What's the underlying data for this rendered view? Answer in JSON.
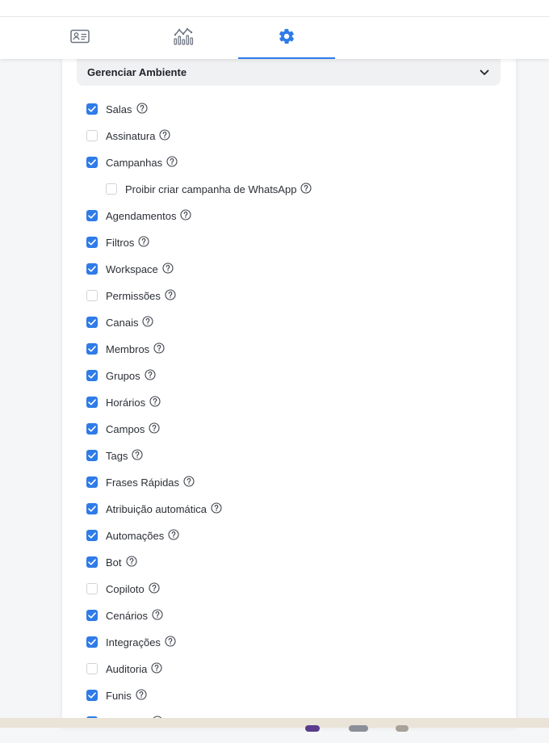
{
  "colors": {
    "accent": "#2f7be8",
    "tab_icon_gray": "#6b7280"
  },
  "tabs": [
    {
      "icon": "contact-card-icon",
      "active": false
    },
    {
      "icon": "analytics-chart-icon",
      "active": false
    },
    {
      "icon": "gear-icon",
      "active": true
    }
  ],
  "section": {
    "title": "Gerenciar Ambiente",
    "expanded": true
  },
  "options": [
    {
      "label": "Salas",
      "checked": true,
      "indent": false
    },
    {
      "label": "Assinatura",
      "checked": false,
      "indent": false
    },
    {
      "label": "Campanhas",
      "checked": true,
      "indent": false
    },
    {
      "label": "Proibir criar campanha de WhatsApp",
      "checked": false,
      "indent": true
    },
    {
      "label": "Agendamentos",
      "checked": true,
      "indent": false
    },
    {
      "label": "Filtros",
      "checked": true,
      "indent": false
    },
    {
      "label": "Workspace",
      "checked": true,
      "indent": false
    },
    {
      "label": "Permissões",
      "checked": false,
      "indent": false
    },
    {
      "label": "Canais",
      "checked": true,
      "indent": false
    },
    {
      "label": "Membros",
      "checked": true,
      "indent": false
    },
    {
      "label": "Grupos",
      "checked": true,
      "indent": false
    },
    {
      "label": "Horários",
      "checked": true,
      "indent": false
    },
    {
      "label": "Campos",
      "checked": true,
      "indent": false
    },
    {
      "label": "Tags",
      "checked": true,
      "indent": false
    },
    {
      "label": "Frases Rápidas",
      "checked": true,
      "indent": false
    },
    {
      "label": "Atribuição automática",
      "checked": true,
      "indent": false
    },
    {
      "label": "Automações",
      "checked": true,
      "indent": false
    },
    {
      "label": "Bot",
      "checked": true,
      "indent": false
    },
    {
      "label": "Copiloto",
      "checked": false,
      "indent": false
    },
    {
      "label": "Cenários",
      "checked": true,
      "indent": false
    },
    {
      "label": "Integrações",
      "checked": true,
      "indent": false
    },
    {
      "label": "Auditoria",
      "checked": false,
      "indent": false
    },
    {
      "label": "Funis",
      "checked": true,
      "indent": false
    },
    {
      "label": "Produtos",
      "checked": true,
      "indent": false
    }
  ]
}
